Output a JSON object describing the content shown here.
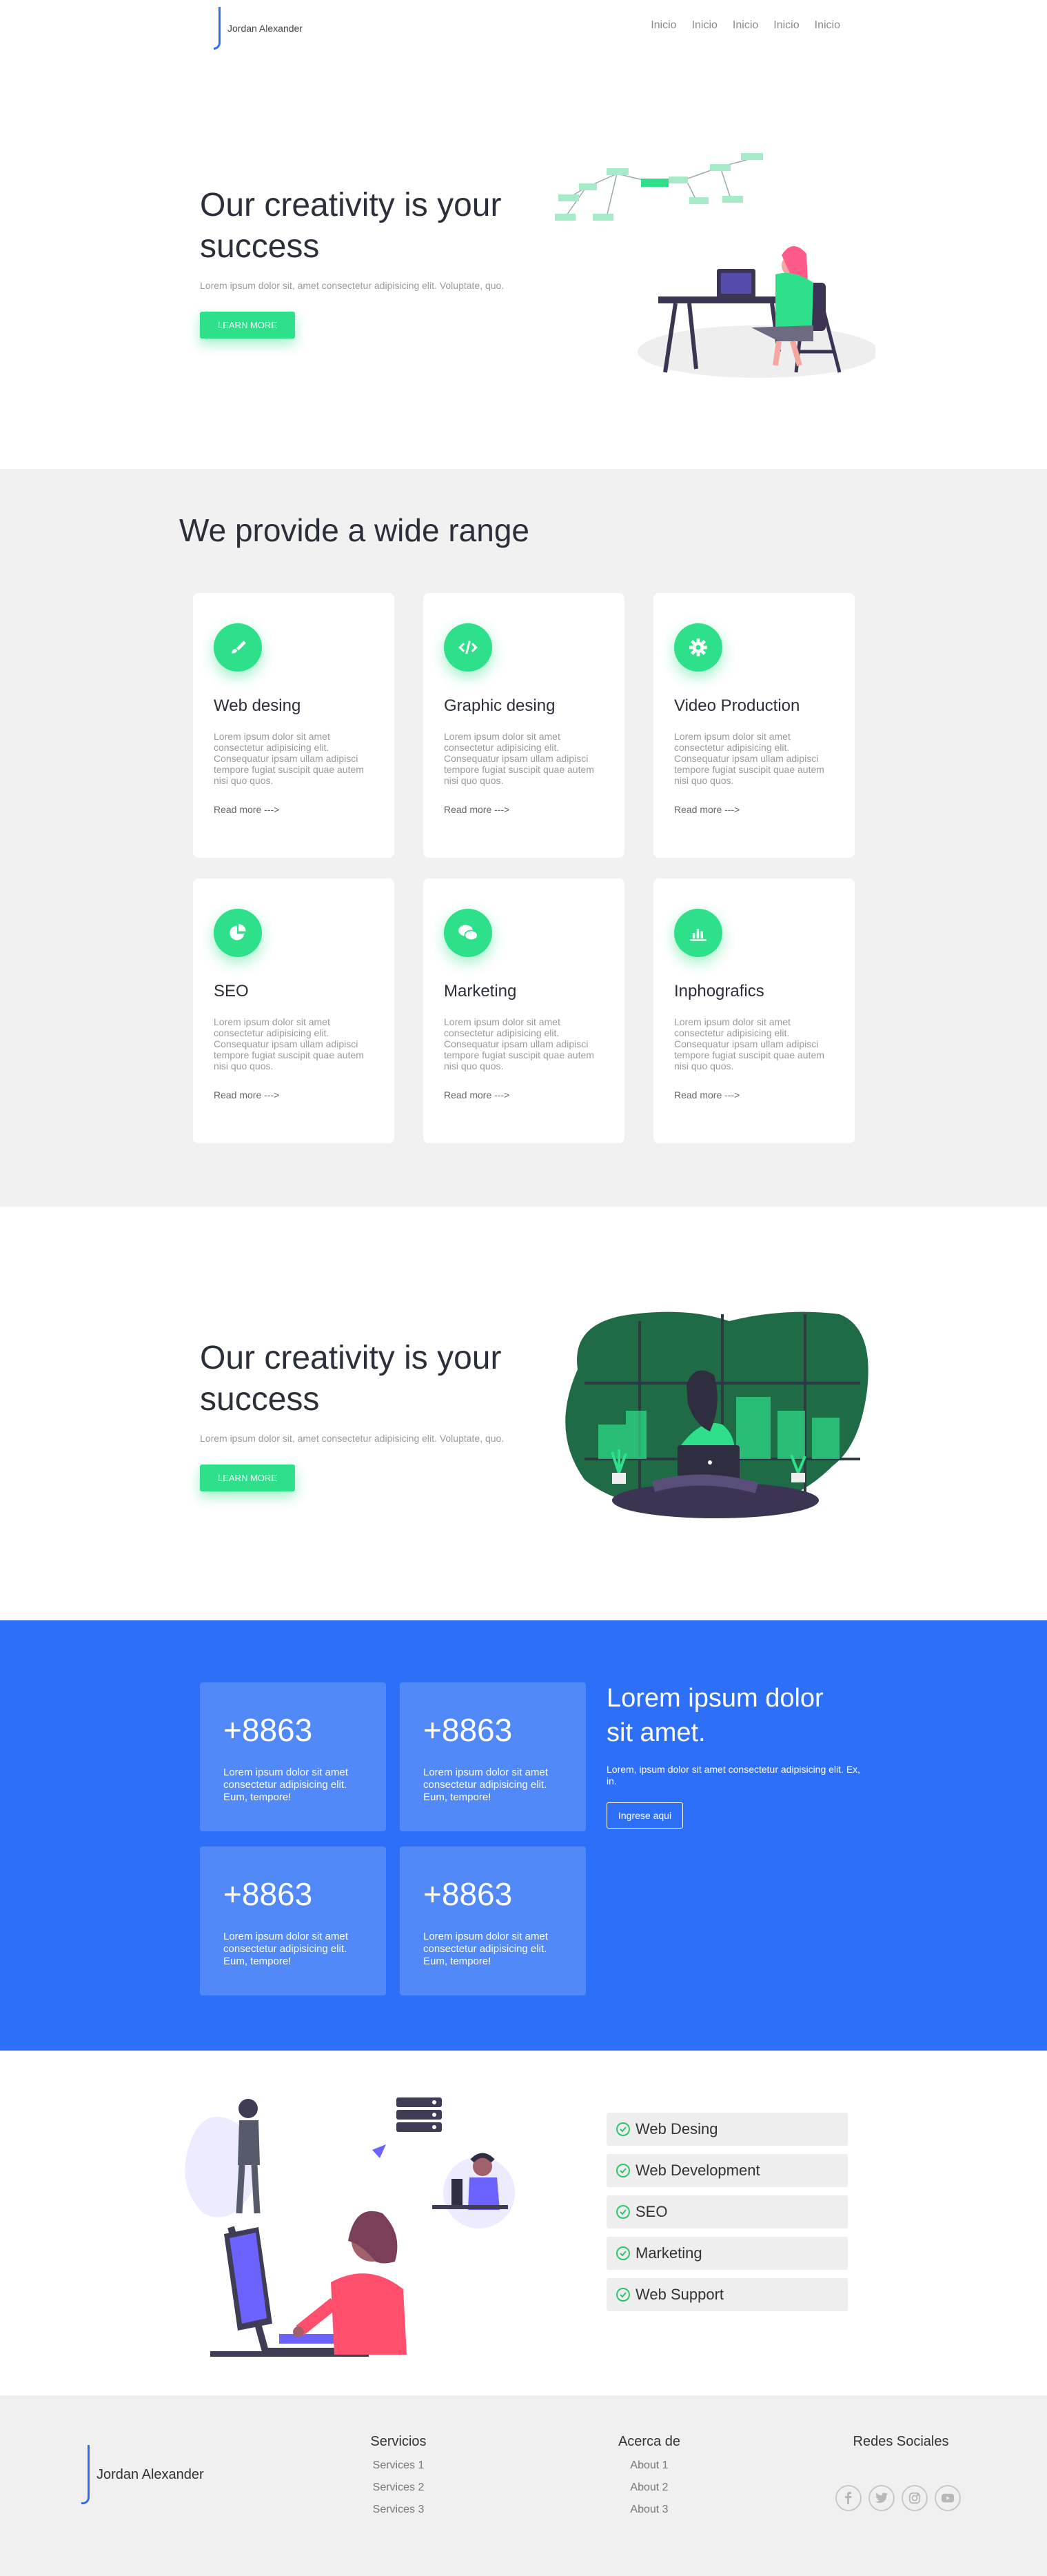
{
  "header": {
    "logo": "Jordan Alexander",
    "nav": [
      "Inicio",
      "Inicio",
      "Inicio",
      "Inicio",
      "Inicio"
    ]
  },
  "hero": {
    "title": "Our creativity is your success",
    "subtitle": "Lorem ipsum dolor sit, amet consectetur adipisicing elit. Voluptate, quo.",
    "button": "LEARN MORE"
  },
  "services": {
    "title": "We provide a wide range",
    "cards": [
      {
        "icon": "paintbrush-icon",
        "title": "Web desing",
        "text": "Lorem ipsum dolor sit amet consectetur adipisicing elit. Consequatur ipsam ullam adipisci tempore fugiat suscipit quae autem nisi quo quos.",
        "link": "Read more --->"
      },
      {
        "icon": "code-icon",
        "title": "Graphic desing",
        "text": "Lorem ipsum dolor sit amet consectetur adipisicing elit. Consequatur ipsam ullam adipisci tempore fugiat suscipit quae autem nisi quo quos.",
        "link": "Read more --->"
      },
      {
        "icon": "gear-icon",
        "title": "Video Production",
        "text": "Lorem ipsum dolor sit amet consectetur adipisicing elit. Consequatur ipsam ullam adipisci tempore fugiat suscipit quae autem nisi quo quos.",
        "link": "Read more --->"
      },
      {
        "icon": "pie-chart-icon",
        "title": "SEO",
        "text": "Lorem ipsum dolor sit amet consectetur adipisicing elit. Consequatur ipsam ullam adipisci tempore fugiat suscipit quae autem nisi quo quos.",
        "link": "Read more --->"
      },
      {
        "icon": "chat-bubbles-icon",
        "title": "Marketing",
        "text": "Lorem ipsum dolor sit amet consectetur adipisicing elit. Consequatur ipsam ullam adipisci tempore fugiat suscipit quae autem nisi quo quos.",
        "link": "Read more --->"
      },
      {
        "icon": "bar-chart-icon",
        "title": "Inphografics",
        "text": "Lorem ipsum dolor sit amet consectetur adipisicing elit. Consequatur ipsam ullam adipisci tempore fugiat suscipit quae autem nisi quo quos.",
        "link": "Read more --->"
      }
    ]
  },
  "creativity2": {
    "title": "Our creativity is your success",
    "subtitle": "Lorem ipsum dolor sit, amet consectetur adipisicing elit. Voluptate, quo.",
    "button": "LEARN MORE"
  },
  "stats": {
    "items": [
      {
        "number": "+8863",
        "text": "Lorem ipsum dolor sit amet consectetur adipisicing elit. Eum, tempore!"
      },
      {
        "number": "+8863",
        "text": "Lorem ipsum dolor sit amet consectetur adipisicing elit. Eum, tempore!"
      },
      {
        "number": "+8863",
        "text": "Lorem ipsum dolor sit amet consectetur adipisicing elit. Eum, tempore!"
      },
      {
        "number": "+8863",
        "text": "Lorem ipsum dolor sit amet consectetur adipisicing elit. Eum, tempore!"
      }
    ],
    "title": "Lorem ipsum dolor sit amet.",
    "subtitle": "Lorem, ipsum dolor sit amet consectetur adipisicing elit. Ex, in.",
    "button": "Ingrese aqui"
  },
  "list": {
    "items": [
      "Web Desing",
      "Web Development",
      "SEO",
      "Marketing",
      "Web Support"
    ]
  },
  "footer": {
    "logo": "Jordan Alexander",
    "servicios": {
      "heading": "Servicios",
      "items": [
        "Services 1",
        "Services 2",
        "Services 3"
      ]
    },
    "acerca": {
      "heading": "Acerca de",
      "items": [
        "About 1",
        "About 2",
        "About 3"
      ]
    },
    "redes": {
      "heading": "Redes Sociales",
      "icons": [
        "facebook-icon",
        "twitter-icon",
        "instagram-icon",
        "youtube-icon"
      ]
    }
  },
  "colors": {
    "accent": "#2ee08a",
    "blue": "#2d6ff7",
    "logo": "#2e6cf6"
  }
}
